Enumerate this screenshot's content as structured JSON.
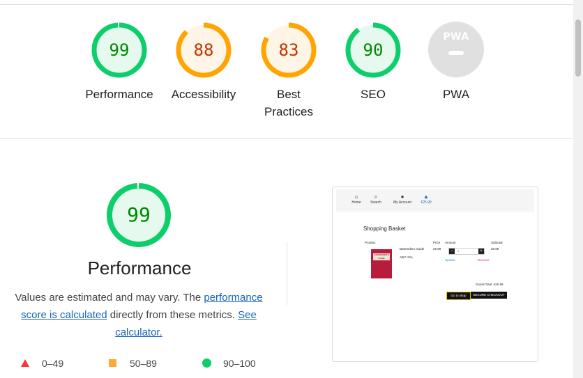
{
  "summary_scores": [
    {
      "label_lines": [
        "Performance"
      ],
      "score": "99",
      "value": 0.99,
      "color": "#0cce6b",
      "fill": "#e6f9ee",
      "text_color": "#008800"
    },
    {
      "label_lines": [
        "Accessibility"
      ],
      "score": "88",
      "value": 0.88,
      "color": "#ffa400",
      "fill": "#fff5e6",
      "text_color": "#c33300"
    },
    {
      "label_lines": [
        "Best",
        "Practices"
      ],
      "score": "83",
      "value": 0.83,
      "color": "#ffa400",
      "fill": "#fff5e6",
      "text_color": "#c33300"
    },
    {
      "label_lines": [
        "SEO"
      ],
      "score": "90",
      "value": 0.9,
      "color": "#0cce6b",
      "fill": "#e6f9ee",
      "text_color": "#008800"
    }
  ],
  "pwa": {
    "badge_text": "PWA",
    "label": "PWA"
  },
  "performance": {
    "score": "99",
    "value": 0.99,
    "title": "Performance",
    "desc_before": "Values are estimated and may vary. The ",
    "link1": "performance score is calculated",
    "desc_middle": " directly from these metrics. ",
    "link2": "See calculator."
  },
  "legend": [
    {
      "shape": "triangle",
      "color": "#ff3333",
      "label": "0–49"
    },
    {
      "shape": "square",
      "color": "#ffaa33",
      "label": "50–89"
    },
    {
      "shape": "circle",
      "color": "#0cce6b",
      "label": "90–100"
    }
  ],
  "thumbnail": {
    "nav": [
      {
        "icon": "home-icon",
        "glyph": "⌂",
        "label": "Home"
      },
      {
        "icon": "search-icon",
        "glyph": "⌕",
        "label": "Search"
      },
      {
        "icon": "user-icon",
        "glyph": "●",
        "label": "My Account"
      },
      {
        "icon": "basket-icon",
        "glyph": "▲",
        "label": "€25.99"
      }
    ],
    "heading": "Shopping Basket",
    "columns": [
      "Product",
      "Price",
      "Amount",
      "Subtotal"
    ],
    "product_name": "Bartenders Guide",
    "book_cover": "BARTENDER'S GUIDE",
    "price": "25.99",
    "abv": "ABV: N/A",
    "qty": "1",
    "subtotal": "25.99",
    "update": "Update",
    "remove": "Remove",
    "grand_total": "Grand Total: €25.99",
    "go_to_shop": "Go to shop",
    "checkout": "SECURE CHECKOUT"
  }
}
